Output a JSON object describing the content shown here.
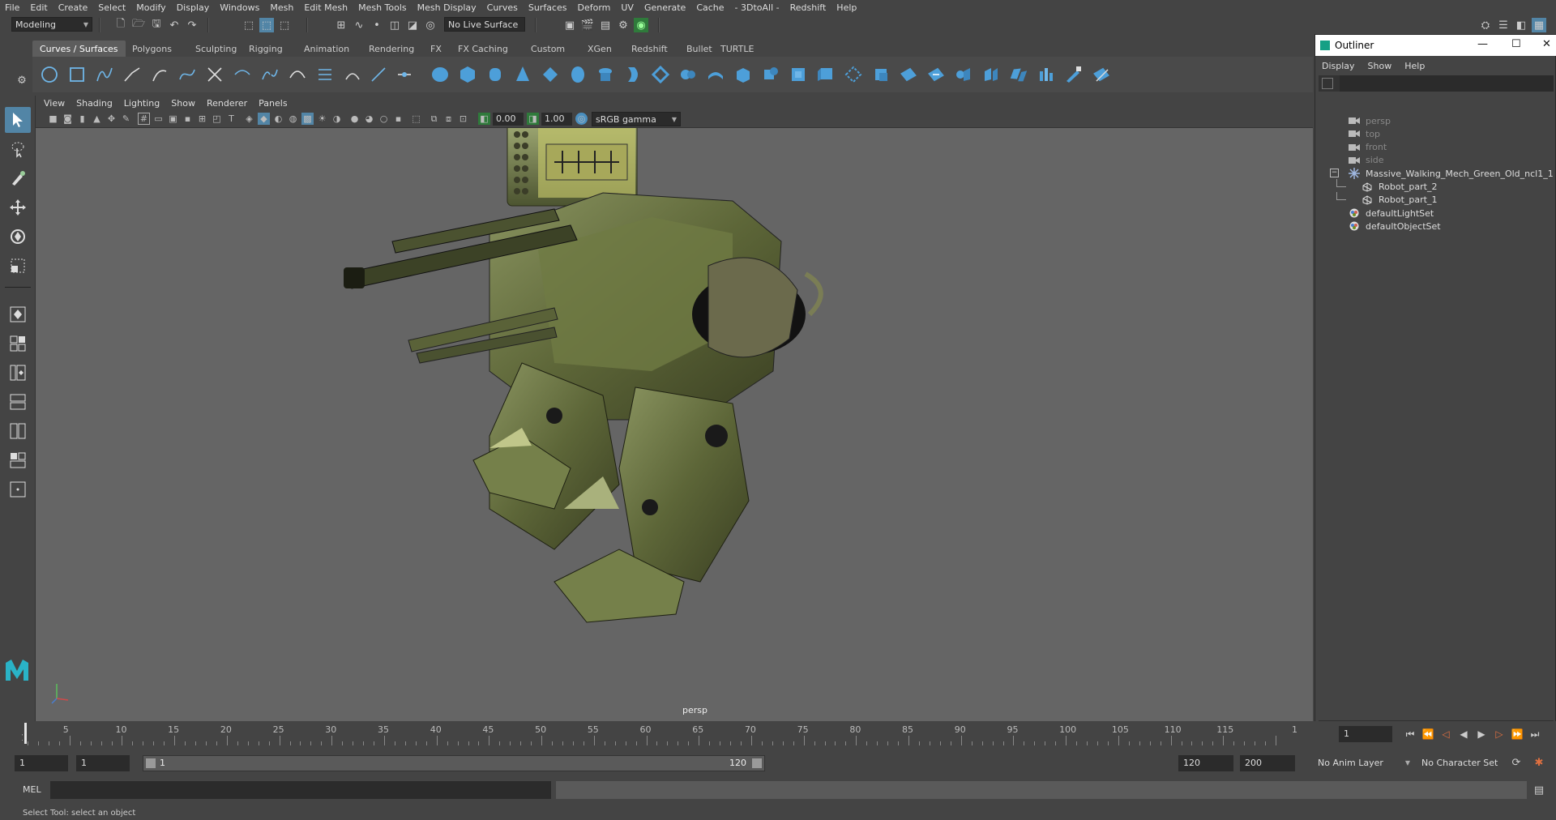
{
  "menu": [
    "File",
    "Edit",
    "Create",
    "Select",
    "Modify",
    "Display",
    "Windows",
    "Mesh",
    "Edit Mesh",
    "Mesh Tools",
    "Mesh Display",
    "Curves",
    "Surfaces",
    "Deform",
    "UV",
    "Generate",
    "Cache",
    "- 3DtoAll -",
    "Redshift",
    "Help"
  ],
  "statusline": {
    "mode": "Modeling",
    "live_surface": "No Live Surface"
  },
  "shelf_tabs": [
    "Curves / Surfaces",
    "Polygons",
    "Sculpting",
    "Rigging",
    "Animation",
    "Rendering",
    "FX",
    "FX Caching",
    "Custom",
    "XGen",
    "Redshift",
    "Bullet",
    "TURTLE"
  ],
  "shelf_active_tab": "Curves / Surfaces",
  "panel_menu": [
    "View",
    "Shading",
    "Lighting",
    "Show",
    "Renderer",
    "Panels"
  ],
  "panel_toolbar": {
    "exposure": "0.00",
    "gamma": "1.00",
    "color_space": "sRGB gamma"
  },
  "viewport": {
    "camera_label": "persp"
  },
  "outliner": {
    "title": "Outliner",
    "menu": [
      "Display",
      "Show",
      "Help"
    ],
    "items": [
      {
        "label": "persp",
        "type": "camera",
        "depth": 0,
        "dim": true
      },
      {
        "label": "top",
        "type": "camera",
        "depth": 0,
        "dim": true
      },
      {
        "label": "front",
        "type": "camera",
        "depth": 0,
        "dim": true
      },
      {
        "label": "side",
        "type": "camera",
        "depth": 0,
        "dim": true
      },
      {
        "label": "Massive_Walking_Mech_Green_Old_ncl1_1",
        "type": "group",
        "depth": 0,
        "expanded": true
      },
      {
        "label": "Robot_part_2",
        "type": "mesh",
        "depth": 1
      },
      {
        "label": "Robot_part_1",
        "type": "mesh",
        "depth": 1
      },
      {
        "label": "defaultLightSet",
        "type": "set",
        "depth": 0
      },
      {
        "label": "defaultObjectSet",
        "type": "set",
        "depth": 0
      }
    ]
  },
  "timeline": {
    "ticks": [
      "5",
      "10",
      "15",
      "20",
      "25",
      "30",
      "35",
      "40",
      "45",
      "50",
      "55",
      "60",
      "65",
      "70",
      "75",
      "80",
      "85",
      "90",
      "95",
      "100",
      "105",
      "110",
      "115",
      "1"
    ],
    "current_frame": "1",
    "left_marker": "1"
  },
  "range": {
    "start": "1",
    "playback_start": "1",
    "range_start": "1",
    "range_end": "120",
    "playback_end": "120",
    "end": "200",
    "anim_layer": "No Anim Layer",
    "character_set": "No Character Set"
  },
  "command_line": {
    "label": "MEL"
  },
  "help_line": "Select Tool: select an object",
  "colors": {
    "active_tab": "#5d5d5d",
    "active_tool": "#5285a6",
    "viewport_bg": "#656565"
  }
}
